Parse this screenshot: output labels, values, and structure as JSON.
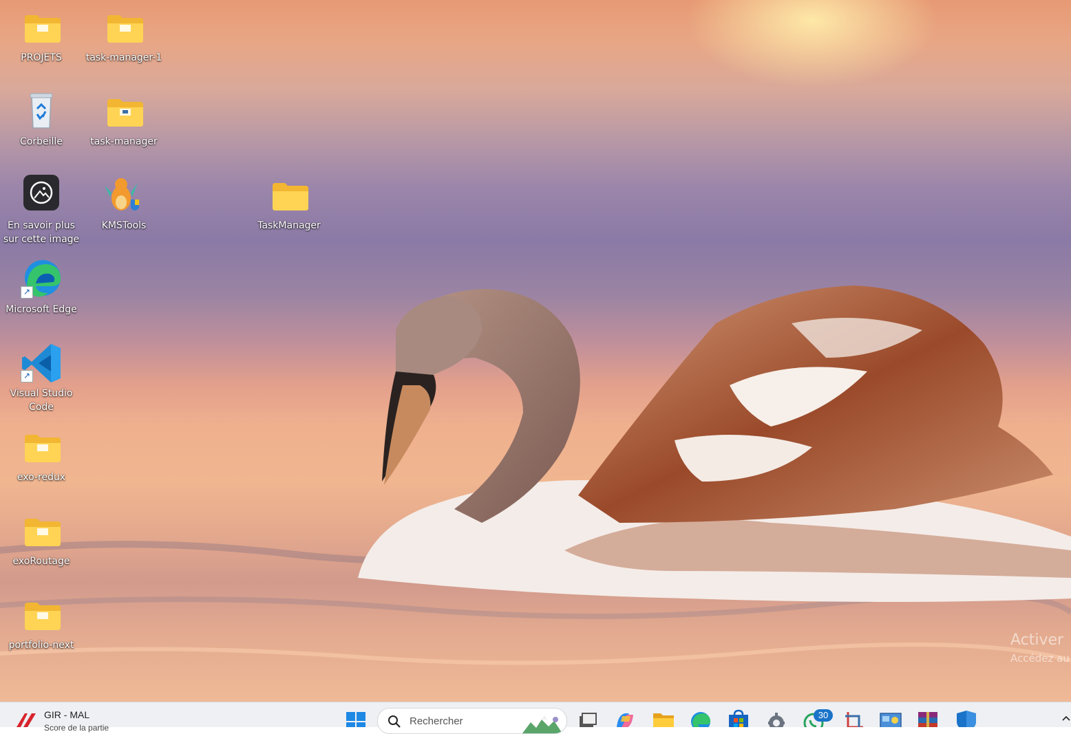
{
  "desktop": {
    "icons": [
      {
        "label": "PROJETS",
        "icon": "folder-icon"
      },
      {
        "label": "task-manager-1",
        "icon": "folder-icon"
      },
      {
        "label": "Corbeille",
        "icon": "recycle-bin-icon"
      },
      {
        "label": "task-manager",
        "icon": "folder-icon"
      },
      {
        "label": "En savoir plus sur cette image",
        "icon": "learn-about-image-icon"
      },
      {
        "label": "KMSTools",
        "icon": "kmstools-dragon-icon"
      },
      {
        "label": "TaskManager",
        "icon": "folder-icon"
      },
      {
        "label": "Microsoft Edge",
        "icon": "edge-icon"
      },
      {
        "label": "Visual Studio Code",
        "icon": "vscode-icon"
      },
      {
        "label": "exo-redux",
        "icon": "folder-icon"
      },
      {
        "label": "exoRoutage",
        "icon": "folder-icon"
      },
      {
        "label": "portfolio-next",
        "icon": "folder-icon"
      }
    ],
    "activation_watermark": {
      "line1": "Activer",
      "line2": "Accédez au"
    }
  },
  "taskbar": {
    "weather_widget": {
      "title": "GIR - MAL",
      "subtitle": "Score de la partie"
    },
    "search": {
      "placeholder": "Rechercher"
    },
    "whatsapp_badge": "30",
    "icons": [
      "start-windows-icon",
      "task-view-icon",
      "copilot-icon",
      "file-explorer-icon",
      "edge-icon",
      "microsoft-store-icon",
      "settings-gear-icon",
      "whatsapp-icon",
      "snipping-tool-icon",
      "control-panel-icon",
      "winrar-icon",
      "windows-security-icon",
      "chevron-up-icon"
    ],
    "accent_color": "#1a73c8"
  }
}
